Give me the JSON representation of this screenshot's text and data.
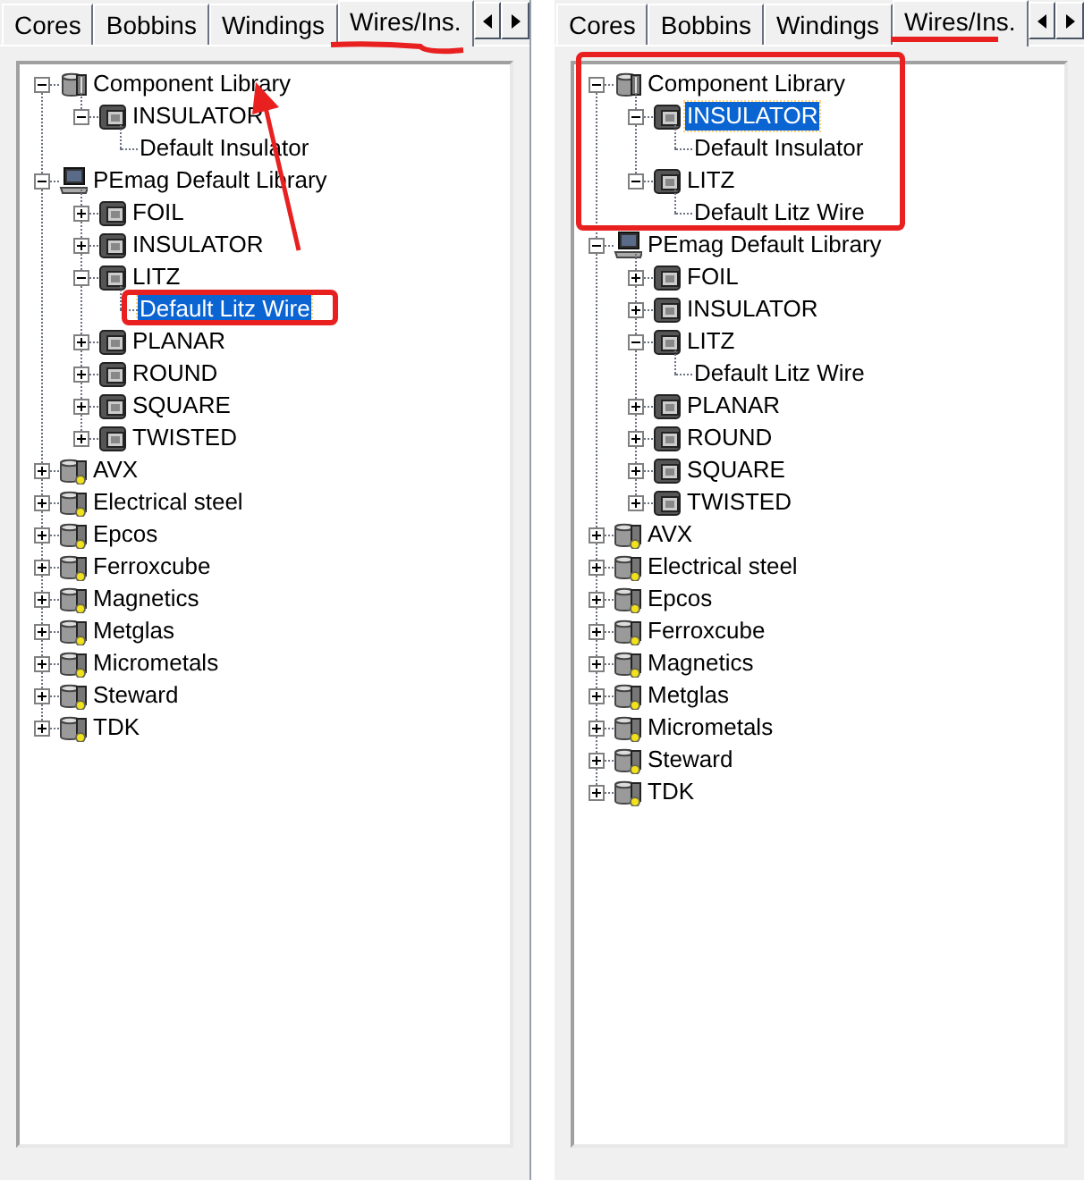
{
  "panels": [
    {
      "tabs": [
        {
          "label": "Cores",
          "selected": false
        },
        {
          "label": "Bobbins",
          "selected": false
        },
        {
          "label": "Windings",
          "selected": false
        },
        {
          "label": "Wires/Ins.",
          "selected": true
        }
      ],
      "tree": [
        {
          "label": "Component Library",
          "kind": "library",
          "expanded": true,
          "selected": false,
          "children": [
            {
              "label": "INSULATOR",
              "kind": "wire-type",
              "expanded": true,
              "selected": false,
              "children": [
                {
                  "label": "Default Insulator",
                  "selected": false
                }
              ]
            }
          ]
        },
        {
          "label": "PEmag Default Library",
          "kind": "computer",
          "expanded": true,
          "selected": false,
          "children": [
            {
              "label": "FOIL",
              "kind": "wire-type",
              "expanded": false,
              "selected": false
            },
            {
              "label": "INSULATOR",
              "kind": "wire-type",
              "expanded": false,
              "selected": false
            },
            {
              "label": "LITZ",
              "kind": "wire-type",
              "expanded": true,
              "selected": false,
              "children": [
                {
                  "label": "Default Litz Wire",
                  "selected": true
                }
              ]
            },
            {
              "label": "PLANAR",
              "kind": "wire-type",
              "expanded": false,
              "selected": false
            },
            {
              "label": "ROUND",
              "kind": "wire-type",
              "expanded": false,
              "selected": false
            },
            {
              "label": "SQUARE",
              "kind": "wire-type",
              "expanded": false,
              "selected": false
            },
            {
              "label": "TWISTED",
              "kind": "wire-type",
              "expanded": false,
              "selected": false
            }
          ]
        },
        {
          "label": "AVX",
          "kind": "vendor",
          "expanded": false,
          "selected": false
        },
        {
          "label": "Electrical steel",
          "kind": "vendor",
          "expanded": false,
          "selected": false
        },
        {
          "label": "Epcos",
          "kind": "vendor",
          "expanded": false,
          "selected": false
        },
        {
          "label": "Ferroxcube",
          "kind": "vendor",
          "expanded": false,
          "selected": false
        },
        {
          "label": "Magnetics",
          "kind": "vendor",
          "expanded": false,
          "selected": false
        },
        {
          "label": "Metglas",
          "kind": "vendor",
          "expanded": false,
          "selected": false
        },
        {
          "label": "Micrometals",
          "kind": "vendor",
          "expanded": false,
          "selected": false
        },
        {
          "label": "Steward",
          "kind": "vendor",
          "expanded": false,
          "selected": false
        },
        {
          "label": "TDK",
          "kind": "vendor",
          "expanded": false,
          "selected": false
        }
      ]
    },
    {
      "tabs": [
        {
          "label": "Cores",
          "selected": false
        },
        {
          "label": "Bobbins",
          "selected": false
        },
        {
          "label": "Windings",
          "selected": false
        },
        {
          "label": "Wires/Ins.",
          "selected": true
        }
      ],
      "tree": [
        {
          "label": "Component Library",
          "kind": "library",
          "expanded": true,
          "selected": false,
          "children": [
            {
              "label": "INSULATOR",
              "kind": "wire-type",
              "expanded": true,
              "selected": true,
              "children": [
                {
                  "label": "Default Insulator",
                  "selected": false
                }
              ]
            },
            {
              "label": "LITZ",
              "kind": "wire-type",
              "expanded": true,
              "selected": false,
              "children": [
                {
                  "label": "Default Litz Wire",
                  "selected": false
                }
              ]
            }
          ]
        },
        {
          "label": "PEmag Default Library",
          "kind": "computer",
          "expanded": true,
          "selected": false,
          "children": [
            {
              "label": "FOIL",
              "kind": "wire-type",
              "expanded": false,
              "selected": false
            },
            {
              "label": "INSULATOR",
              "kind": "wire-type",
              "expanded": false,
              "selected": false
            },
            {
              "label": "LITZ",
              "kind": "wire-type",
              "expanded": true,
              "selected": false,
              "children": [
                {
                  "label": "Default Litz Wire",
                  "selected": false
                }
              ]
            },
            {
              "label": "PLANAR",
              "kind": "wire-type",
              "expanded": false,
              "selected": false
            },
            {
              "label": "ROUND",
              "kind": "wire-type",
              "expanded": false,
              "selected": false
            },
            {
              "label": "SQUARE",
              "kind": "wire-type",
              "expanded": false,
              "selected": false
            },
            {
              "label": "TWISTED",
              "kind": "wire-type",
              "expanded": false,
              "selected": false
            }
          ]
        },
        {
          "label": "AVX",
          "kind": "vendor",
          "expanded": false,
          "selected": false
        },
        {
          "label": "Electrical steel",
          "kind": "vendor",
          "expanded": false,
          "selected": false
        },
        {
          "label": "Epcos",
          "kind": "vendor",
          "expanded": false,
          "selected": false
        },
        {
          "label": "Ferroxcube",
          "kind": "vendor",
          "expanded": false,
          "selected": false
        },
        {
          "label": "Magnetics",
          "kind": "vendor",
          "expanded": false,
          "selected": false
        },
        {
          "label": "Metglas",
          "kind": "vendor",
          "expanded": false,
          "selected": false
        },
        {
          "label": "Micrometals",
          "kind": "vendor",
          "expanded": false,
          "selected": false
        },
        {
          "label": "Steward",
          "kind": "vendor",
          "expanded": false,
          "selected": false
        },
        {
          "label": "TDK",
          "kind": "vendor",
          "expanded": false,
          "selected": false
        }
      ]
    }
  ]
}
